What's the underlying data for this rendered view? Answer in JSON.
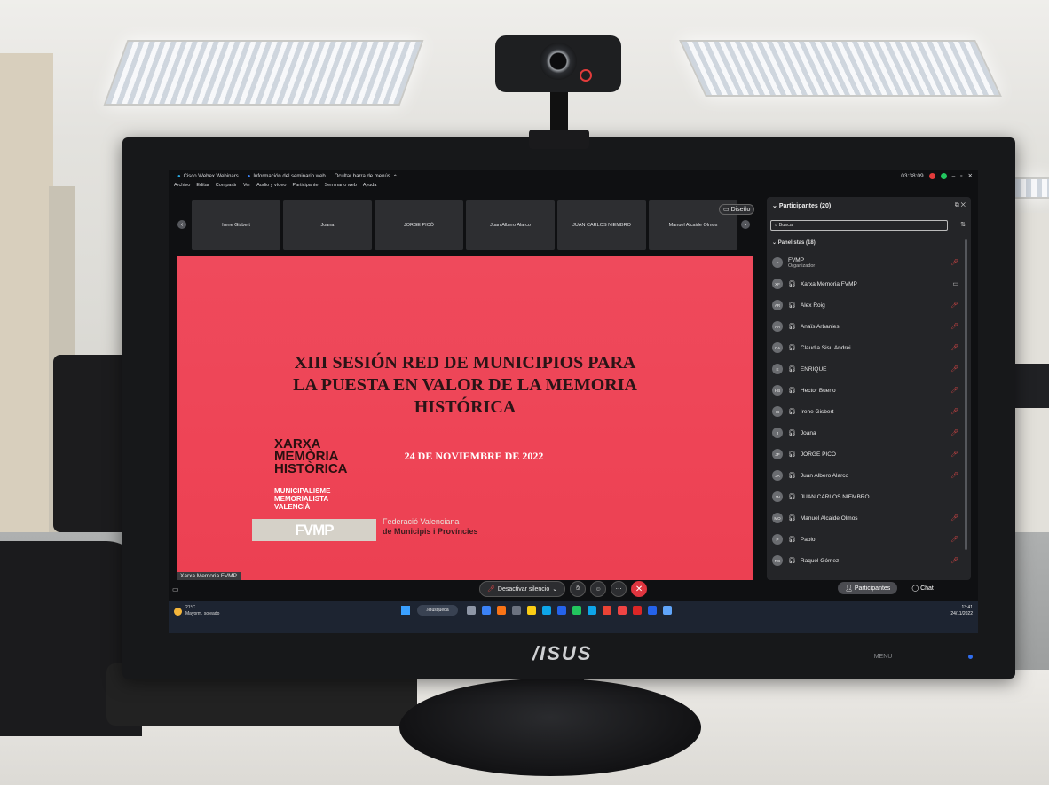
{
  "webex": {
    "app_title": "Cisco Webex Webinars",
    "seminar_info": "Información del seminario web",
    "hide_menu": "Ocultar barra de menús",
    "timer": "03:38:09",
    "menu": [
      "Archivo",
      "Editar",
      "Compartir",
      "Ver",
      "Audio y vídeo",
      "Participante",
      "Seminario web",
      "Ayuda"
    ]
  },
  "video_strip": {
    "tiles": [
      "Irene Gisbert",
      "Joana",
      "JORGE PICÓ",
      "Juan Albero Alarco",
      "JUAN CARLOS NIEMBRO",
      "Manuel Alcaide Olmos"
    ],
    "layout_button": "Diseño"
  },
  "slide": {
    "title_lines": [
      "XIII SESIÓN RED DE MUNICIPIOS PARA",
      "LA PUESTA EN VALOR DE LA MEMORIA",
      "HISTÓRICA"
    ],
    "date": "24 DE NOVIEMBRE DE 2022",
    "logo_lines": [
      "XARXA",
      "MEMÒRIA",
      "HISTÒRICA"
    ],
    "logo_sub_lines": [
      "MUNICIPALISME",
      "MEMORIALISTA",
      "VALENCIÀ"
    ],
    "fvmp_logo": "FVMP",
    "fvmp_line1": "Federació Valenciana",
    "fvmp_line2": "de Municipis i Províncies",
    "owner": "Xarxa Memoria FVMP"
  },
  "controls": {
    "unmute": "Desactivar silencio"
  },
  "panel": {
    "title": "Participantes (20)",
    "search_placeholder": "Buscar",
    "group": "Panelistas (18)",
    "participants": [
      {
        "initials": "F",
        "name": "FVMP",
        "role": "Organizador",
        "muted": true
      },
      {
        "initials": "XF",
        "name": "Xarxa Memoria FVMP",
        "muted": false
      },
      {
        "initials": "AR",
        "name": "Alex Roig",
        "muted": true
      },
      {
        "initials": "AA",
        "name": "Anaïs Arbanies",
        "muted": true
      },
      {
        "initials": "CA",
        "name": "Claudia Sisu Andrei",
        "muted": true
      },
      {
        "initials": "E",
        "name": "ENRIQUE",
        "muted": true
      },
      {
        "initials": "HB",
        "name": "Hector Bueno",
        "muted": true
      },
      {
        "initials": "IG",
        "name": "Irene Gisbert",
        "muted": true
      },
      {
        "initials": "J",
        "name": "Joana",
        "muted": true
      },
      {
        "initials": "JP",
        "name": "JORGE PICÓ",
        "muted": true
      },
      {
        "initials": "JA",
        "name": "Juan Albero Alarco",
        "muted": true
      },
      {
        "initials": "JN",
        "name": "JUAN CARLOS NIEMBRO",
        "muted": false
      },
      {
        "initials": "MO",
        "name": "Manuel Alcaide Olmos",
        "muted": true
      },
      {
        "initials": "P",
        "name": "Pablo",
        "muted": true
      },
      {
        "initials": "RG",
        "name": "Raquel Gómez",
        "muted": true
      }
    ],
    "tab_participants": "Participantes",
    "tab_chat": "Chat"
  },
  "taskbar": {
    "temp": "21°C",
    "weather": "Mayorm. soleado",
    "search": "Búsqueda",
    "time": "13:41",
    "date": "24/11/2022",
    "icon_colors": [
      "#8e96a6",
      "#3b82f6",
      "#f97316",
      "#6b7280",
      "#facc15",
      "#0ea5e9",
      "#2563eb",
      "#22c55e",
      "#0ea5e9",
      "#ea4335",
      "#ef4444",
      "#dc2626",
      "#2563eb",
      "#60a5fa"
    ]
  },
  "monitor": {
    "brand": "/ISUS",
    "buttons": [
      "",
      "",
      "MENU",
      "",
      "",
      ""
    ]
  }
}
